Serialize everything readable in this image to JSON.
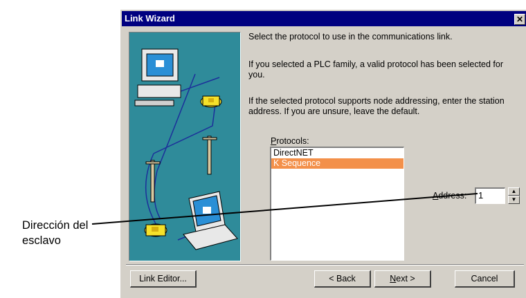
{
  "window": {
    "title": "Link Wizard",
    "close_glyph": "✕"
  },
  "instructions": {
    "p1": "Select the protocol to use in the communications link.",
    "p2": "If you selected a PLC family, a valid protocol has been selected for you.",
    "p3": "If the selected protocol supports node addressing, enter the station address. If you are unsure, leave the default."
  },
  "protocols": {
    "label_prefix": "",
    "label_accel": "P",
    "label_rest": "rotocols:",
    "items": [
      "DirectNET",
      "K Sequence"
    ],
    "selected": "K Sequence"
  },
  "address": {
    "label_accel": "A",
    "label_rest": "ddress:",
    "value": "1"
  },
  "buttons": {
    "link_editor": "Link Editor...",
    "back": "< Back",
    "next_accel": "N",
    "next_rest": "ext >",
    "cancel": "Cancel"
  },
  "annotation": {
    "line1": "Dirección del",
    "line2": "esclavo"
  },
  "colors": {
    "titlebar": "#000080",
    "selection": "#f3904a",
    "art_background": "#2f8b9a"
  }
}
